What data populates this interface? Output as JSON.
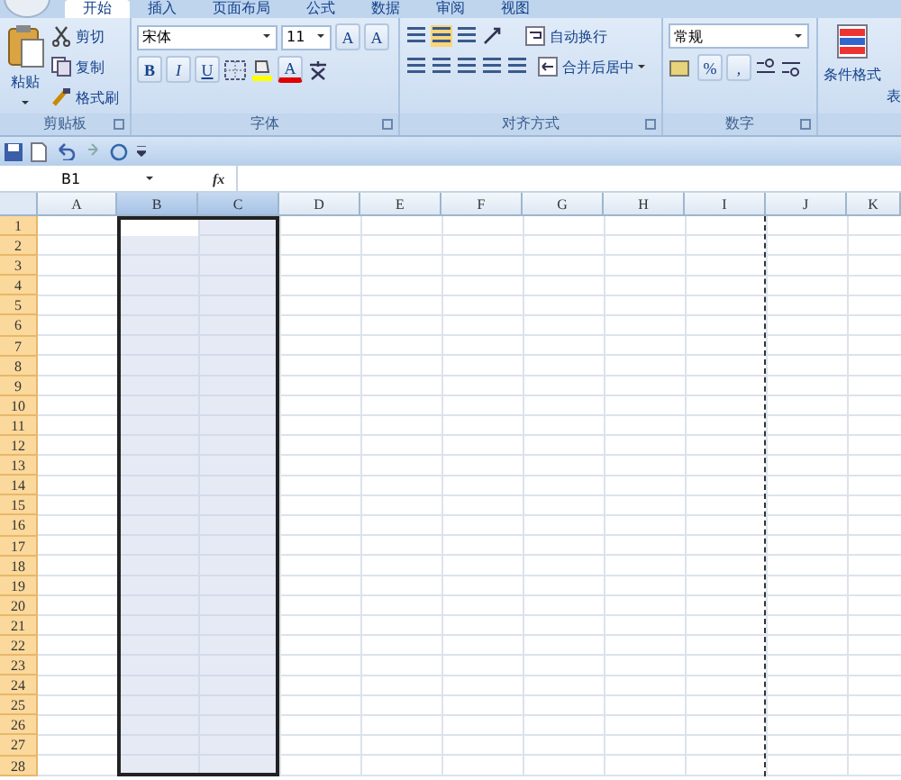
{
  "tabs": [
    {
      "label": "开始",
      "selected": true
    },
    {
      "label": "插入",
      "selected": false
    },
    {
      "label": "页面布局",
      "selected": false
    },
    {
      "label": "公式",
      "selected": false
    },
    {
      "label": "数据",
      "selected": false
    },
    {
      "label": "审阅",
      "selected": false
    },
    {
      "label": "视图",
      "selected": false
    }
  ],
  "ribbon": {
    "groups": [
      {
        "kind": "clipboard",
        "label": "剪贴板",
        "paste": "粘贴",
        "commands": [
          "剪切",
          "复制",
          "格式刷"
        ]
      },
      {
        "kind": "font",
        "label": "字体",
        "font_name": "宋体",
        "font_size": "11",
        "grow": "A",
        "shrink": "A",
        "bold": "B",
        "italic": "I",
        "underline": "U",
        "font_color": "A"
      },
      {
        "kind": "alignment",
        "label": "对齐方式",
        "wrap_text": "自动换行",
        "merge": "合并后居中"
      },
      {
        "kind": "number",
        "label": "数字",
        "format": "常规",
        "percent": "%",
        "comma": ","
      },
      {
        "kind": "styles",
        "conditional": "条件格式",
        "table": "表"
      }
    ]
  },
  "name_box": "B1",
  "function_label": "fx",
  "columns": [
    {
      "label": "A",
      "selected": false,
      "page_break_after": false
    },
    {
      "label": "B",
      "selected": true,
      "page_break_after": false
    },
    {
      "label": "C",
      "selected": true,
      "page_break_after": false
    },
    {
      "label": "D",
      "selected": false,
      "page_break_after": false
    },
    {
      "label": "E",
      "selected": false,
      "page_break_after": false
    },
    {
      "label": "F",
      "selected": false,
      "page_break_after": false
    },
    {
      "label": "G",
      "selected": false,
      "page_break_after": false
    },
    {
      "label": "H",
      "selected": false,
      "page_break_after": false
    },
    {
      "label": "I",
      "selected": false,
      "page_break_after": true
    },
    {
      "label": "J",
      "selected": false,
      "page_break_after": false
    },
    {
      "label": "K",
      "selected": false,
      "page_break_after": false
    }
  ],
  "rows": [
    {
      "label": "1",
      "selected": true
    },
    {
      "label": "2",
      "selected": true
    },
    {
      "label": "3",
      "selected": true
    },
    {
      "label": "4",
      "selected": true
    },
    {
      "label": "5",
      "selected": true
    },
    {
      "label": "6",
      "selected": true
    },
    {
      "label": "7",
      "selected": true
    },
    {
      "label": "8",
      "selected": true
    },
    {
      "label": "9",
      "selected": true
    },
    {
      "label": "10",
      "selected": true
    },
    {
      "label": "11",
      "selected": true
    },
    {
      "label": "12",
      "selected": true
    },
    {
      "label": "13",
      "selected": true
    },
    {
      "label": "14",
      "selected": true
    },
    {
      "label": "15",
      "selected": true
    },
    {
      "label": "16",
      "selected": true
    },
    {
      "label": "17",
      "selected": true
    },
    {
      "label": "18",
      "selected": true
    },
    {
      "label": "19",
      "selected": true
    },
    {
      "label": "20",
      "selected": true
    },
    {
      "label": "21",
      "selected": true
    },
    {
      "label": "22",
      "selected": true
    },
    {
      "label": "23",
      "selected": true
    },
    {
      "label": "24",
      "selected": true
    },
    {
      "label": "25",
      "selected": true
    },
    {
      "label": "26",
      "selected": true
    },
    {
      "label": "27",
      "selected": true
    },
    {
      "label": "28",
      "selected": true
    }
  ]
}
